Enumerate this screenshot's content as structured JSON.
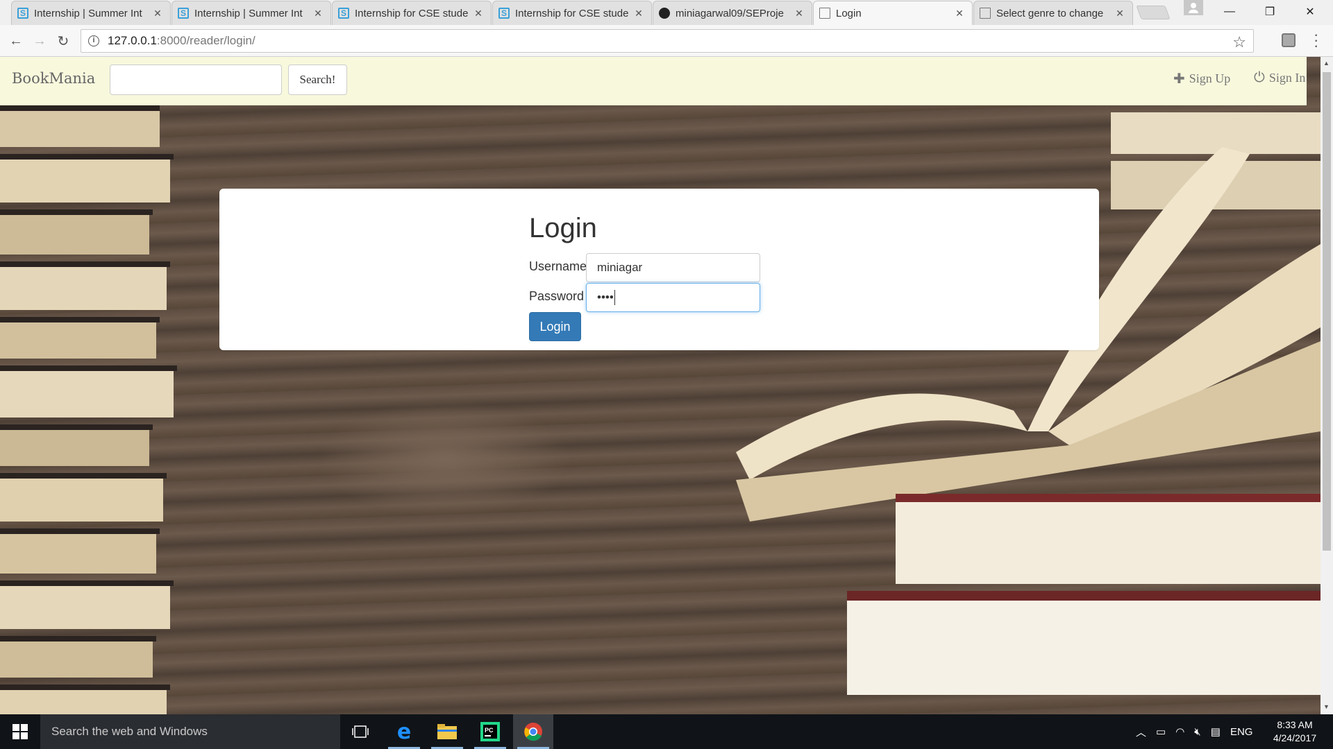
{
  "browser": {
    "tabs": [
      {
        "title": "Internship | Summer Int",
        "icon": "internshala-icon",
        "active": false
      },
      {
        "title": "Internship | Summer Int",
        "icon": "internshala-icon",
        "active": false
      },
      {
        "title": "Internship for CSE stude",
        "icon": "internshala-icon",
        "active": false
      },
      {
        "title": "Internship for CSE stude",
        "icon": "internshala-icon",
        "active": false
      },
      {
        "title": "miniagarwal09/SEProje",
        "icon": "github-icon",
        "active": false
      },
      {
        "title": "Login",
        "icon": "document-icon",
        "active": true
      },
      {
        "title": "Select genre to change",
        "icon": "document-icon",
        "active": false
      }
    ],
    "url_host": "127.0.0.1",
    "url_path": ":8000/reader/login/"
  },
  "navbar": {
    "brand": "BookMania",
    "search_placeholder": "",
    "search_button": "Search!",
    "signup_label": "Sign Up",
    "signin_label": "Sign In"
  },
  "login": {
    "title": "Login",
    "username_label": "Username",
    "username_value": "miniagar",
    "password_label": "Password",
    "password_value": "••••",
    "submit_label": "Login"
  },
  "taskbar": {
    "search_text": "Search the web and Windows",
    "language": "ENG",
    "time": "8:33 AM",
    "date": "4/24/2017"
  },
  "colors": {
    "navbar_bg": "#f8f8dd",
    "primary_button": "#337ab7",
    "focus_border": "#66afe9"
  }
}
